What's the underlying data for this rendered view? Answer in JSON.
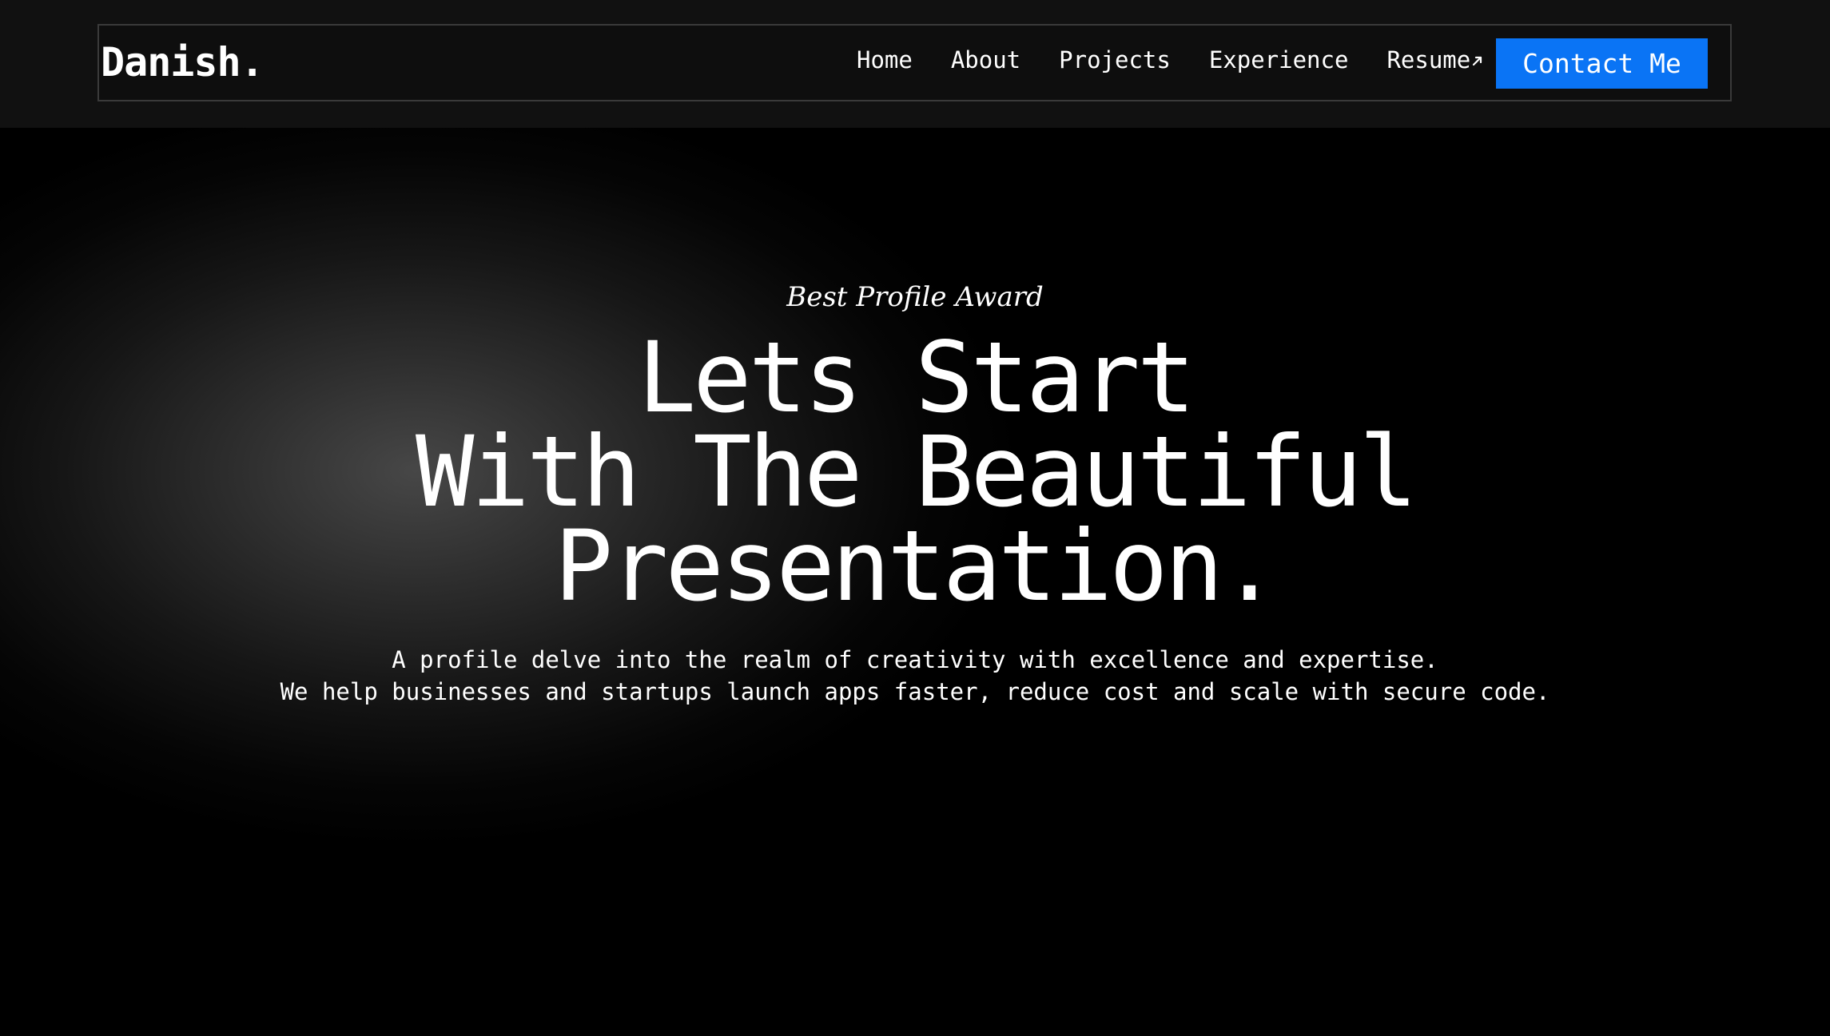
{
  "header": {
    "logo": "Danish.",
    "nav": {
      "home": "Home",
      "about": "About",
      "projects": "Projects",
      "experience": "Experience",
      "resume": "Resume",
      "resume_icon": "external-arrow-icon"
    },
    "contact_button": "Contact Me"
  },
  "hero": {
    "award": "Best Profile Award",
    "headline_lines": [
      "Lets Start",
      "With The Beautiful",
      "Presentation."
    ],
    "description_lines": [
      "A profile delve into the realm of creativity with excellence and expertise.",
      "We help businesses and startups launch apps faster, reduce cost and scale with secure code."
    ]
  },
  "colors": {
    "accent": "#0a74f5",
    "background": "#000000",
    "header_background": "#111111",
    "text": "#ffffff"
  }
}
